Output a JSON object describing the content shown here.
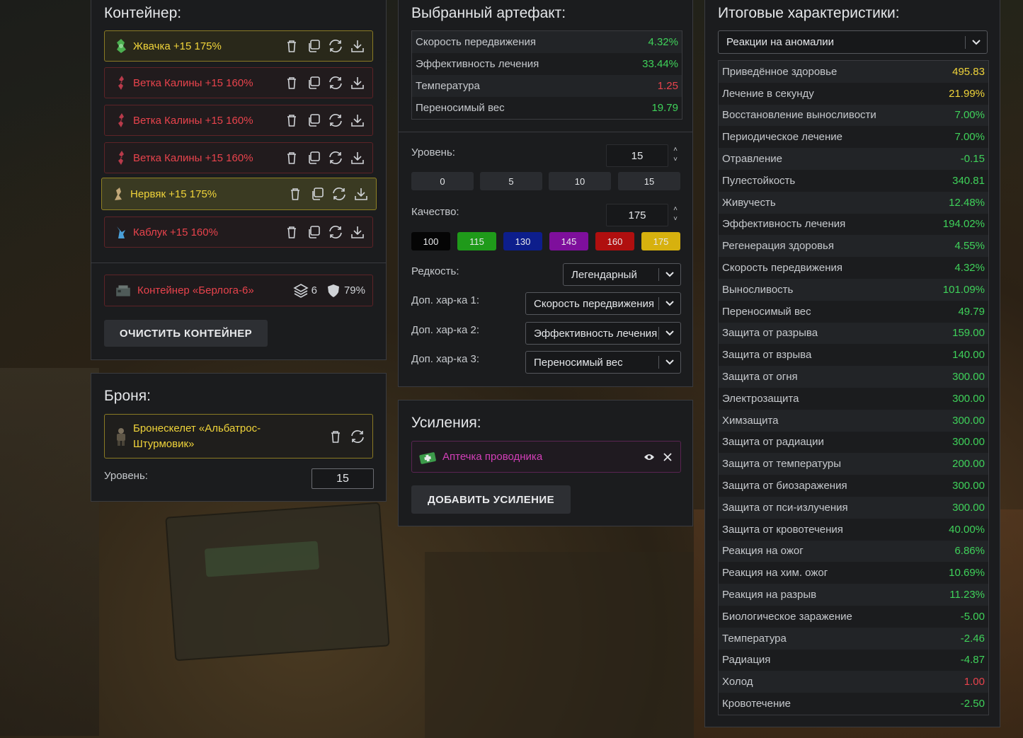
{
  "container": {
    "title": "Контейнер:",
    "items": [
      {
        "label": "Жвачка +15 175%",
        "color": "gold",
        "icon": "artifact-green-icon"
      },
      {
        "label": "Ветка Калины +15 160%",
        "color": "red",
        "icon": "artifact-red-icon"
      },
      {
        "label": "Ветка Калины +15 160%",
        "color": "red",
        "icon": "artifact-red-icon"
      },
      {
        "label": "Ветка Калины +15 160%",
        "color": "red",
        "icon": "artifact-red-icon"
      },
      {
        "label": "Нервяк +15 175%",
        "color": "gold",
        "icon": "artifact-beige-icon"
      },
      {
        "label": "Каблук +15 160%",
        "color": "red",
        "icon": "artifact-blue-icon"
      }
    ],
    "box": {
      "name": "Контейнер «Берлога-6»",
      "slots": "6",
      "protection": "79%"
    },
    "clear_button": "ОЧИСТИТЬ КОНТЕЙНЕР"
  },
  "armor": {
    "title": "Броня:",
    "name_line1": "Бронескелет «Альбатрос-",
    "name_line2": "Штурмовик»",
    "level_label": "Уровень:",
    "level_value": "15"
  },
  "artifact": {
    "title": "Выбранный артефакт:",
    "stats": [
      {
        "k": "Скорость передвижения",
        "v": "4.32%",
        "c": "green"
      },
      {
        "k": "Эффективность лечения",
        "v": "33.44%",
        "c": "green"
      },
      {
        "k": "Температура",
        "v": "1.25",
        "c": "red"
      },
      {
        "k": "Переносимый вес",
        "v": "19.79",
        "c": "green"
      }
    ],
    "level_label": "Уровень:",
    "level_value": "15",
    "level_chips": [
      "0",
      "5",
      "10",
      "15"
    ],
    "quality_label": "Качество:",
    "quality_value": "175",
    "quality_chips": [
      {
        "v": "100",
        "bg": "#050505"
      },
      {
        "v": "115",
        "bg": "#1f9a1a"
      },
      {
        "v": "130",
        "bg": "#0d1e8c"
      },
      {
        "v": "145",
        "bg": "#7e0f9c"
      },
      {
        "v": "160",
        "bg": "#b00f0f"
      },
      {
        "v": "175",
        "bg": "#d7b10e"
      }
    ],
    "rarity_label": "Редкость:",
    "rarity_value": "Легендарный",
    "extra1_label": "Доп. хар-ка 1:",
    "extra1_value": "Скорость передвижения",
    "extra2_label": "Доп. хар-ка 2:",
    "extra2_value": "Эффективность лечения",
    "extra3_label": "Доп. хар-ка 3:",
    "extra3_value": "Переносимый вес"
  },
  "boosts": {
    "title": "Усиления:",
    "item": "Аптечка проводника",
    "add_button": "ДОБАВИТЬ УСИЛЕНИЕ"
  },
  "totals": {
    "title": "Итоговые характеристики:",
    "filter": "Реакции на аномалии",
    "stats": [
      {
        "k": "Приведённое здоровье",
        "v": "495.83",
        "c": "yellow"
      },
      {
        "k": "Лечение в секунду",
        "v": "21.99%",
        "c": "yellow"
      },
      {
        "k": "Восстановление выносливости",
        "v": "7.00%",
        "c": "green"
      },
      {
        "k": "Периодическое лечение",
        "v": "7.00%",
        "c": "green"
      },
      {
        "k": "Отравление",
        "v": "-0.15",
        "c": "green"
      },
      {
        "k": "Пулестойкость",
        "v": "340.81",
        "c": "green"
      },
      {
        "k": "Живучесть",
        "v": "12.48%",
        "c": "green"
      },
      {
        "k": "Эффективность лечения",
        "v": "194.02%",
        "c": "green"
      },
      {
        "k": "Регенерация здоровья",
        "v": "4.55%",
        "c": "green"
      },
      {
        "k": "Скорость передвижения",
        "v": "4.32%",
        "c": "green"
      },
      {
        "k": "Выносливость",
        "v": "101.09%",
        "c": "green"
      },
      {
        "k": "Переносимый вес",
        "v": "49.79",
        "c": "green"
      },
      {
        "k": "Защита от разрыва",
        "v": "159.00",
        "c": "green"
      },
      {
        "k": "Защита от взрыва",
        "v": "140.00",
        "c": "green"
      },
      {
        "k": "Защита от огня",
        "v": "300.00",
        "c": "green"
      },
      {
        "k": "Электрозащита",
        "v": "300.00",
        "c": "green"
      },
      {
        "k": "Химзащита",
        "v": "300.00",
        "c": "green"
      },
      {
        "k": "Защита от радиации",
        "v": "300.00",
        "c": "green"
      },
      {
        "k": "Защита от температуры",
        "v": "200.00",
        "c": "green"
      },
      {
        "k": "Защита от биозаражения",
        "v": "300.00",
        "c": "green"
      },
      {
        "k": "Защита от пси-излучения",
        "v": "300.00",
        "c": "green"
      },
      {
        "k": "Защита от кровотечения",
        "v": "40.00%",
        "c": "green"
      },
      {
        "k": "Реакция на ожог",
        "v": "6.86%",
        "c": "green"
      },
      {
        "k": "Реакция на хим. ожог",
        "v": "10.69%",
        "c": "green"
      },
      {
        "k": "Реакция на разрыв",
        "v": "11.23%",
        "c": "green"
      },
      {
        "k": "Биологическое заражение",
        "v": "-5.00",
        "c": "green"
      },
      {
        "k": "Температура",
        "v": "-2.46",
        "c": "green"
      },
      {
        "k": "Радиация",
        "v": "-4.87",
        "c": "green"
      },
      {
        "k": "Холод",
        "v": "1.00",
        "c": "red"
      },
      {
        "k": "Кровотечение",
        "v": "-2.50",
        "c": "green"
      }
    ]
  }
}
